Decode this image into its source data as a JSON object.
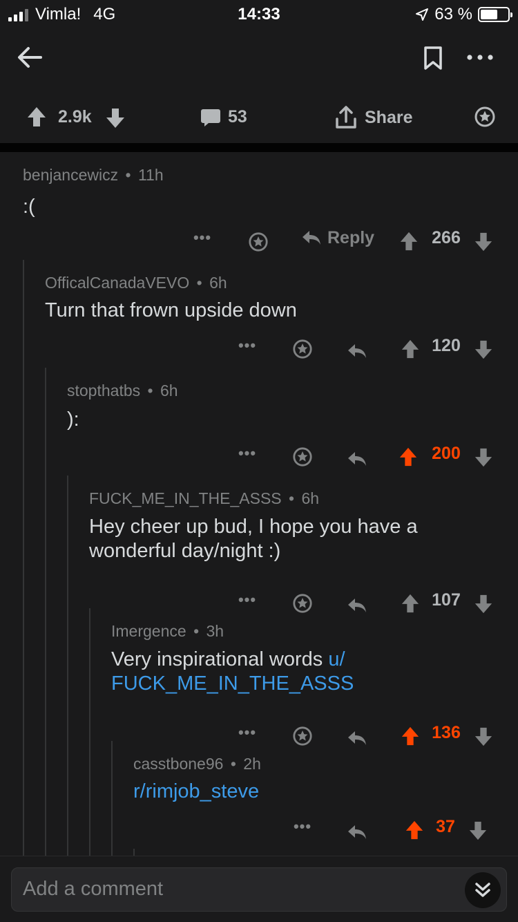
{
  "status_bar": {
    "carrier": "Vimla!",
    "network": "4G",
    "time": "14:33",
    "battery": "63 %",
    "battery_level": 0.63
  },
  "post": {
    "upvotes": "2.9k",
    "comments": "53",
    "share_label": "Share"
  },
  "comments": [
    {
      "author": "benjancewicz",
      "age": "11h",
      "body": ":(",
      "score": "266",
      "reply_label": "Reply",
      "upvoted": false
    },
    {
      "author": "OfficalCanadaVEVO",
      "age": "6h",
      "body": "Turn that frown upside down",
      "score": "120",
      "upvoted": false
    },
    {
      "author": "stopthatbs",
      "age": "6h",
      "body": "):",
      "score": "200",
      "upvoted": true
    },
    {
      "author": "FUCK_ME_IN_THE_ASSS",
      "age": "6h",
      "body": "Hey cheer up bud, I hope you have a wonderful day/night :)",
      "score": "107",
      "upvoted": false
    },
    {
      "author": "Imergence",
      "age": "3h",
      "body": "Very inspirational words ",
      "body_link": "u/ FUCK_ME_IN_THE_ASSS",
      "score": "136",
      "upvoted": true
    },
    {
      "author": "casstbone96",
      "age": "2h",
      "body_link": "r/rimjob_steve",
      "score": "37",
      "upvoted": true
    }
  ],
  "meta_separator": "•",
  "composer": {
    "placeholder": "Add a comment"
  },
  "colors": {
    "background": "#1a1a1b",
    "upvote": "#ff4500",
    "link": "#3d9be9",
    "muted": "#818384",
    "text": "#d7dadc"
  },
  "icons": [
    "back-arrow-icon",
    "bookmark-icon",
    "more-icon",
    "upvote-icon",
    "downvote-icon",
    "comment-icon",
    "share-icon",
    "award-icon",
    "reply-icon",
    "collapse-icon"
  ]
}
